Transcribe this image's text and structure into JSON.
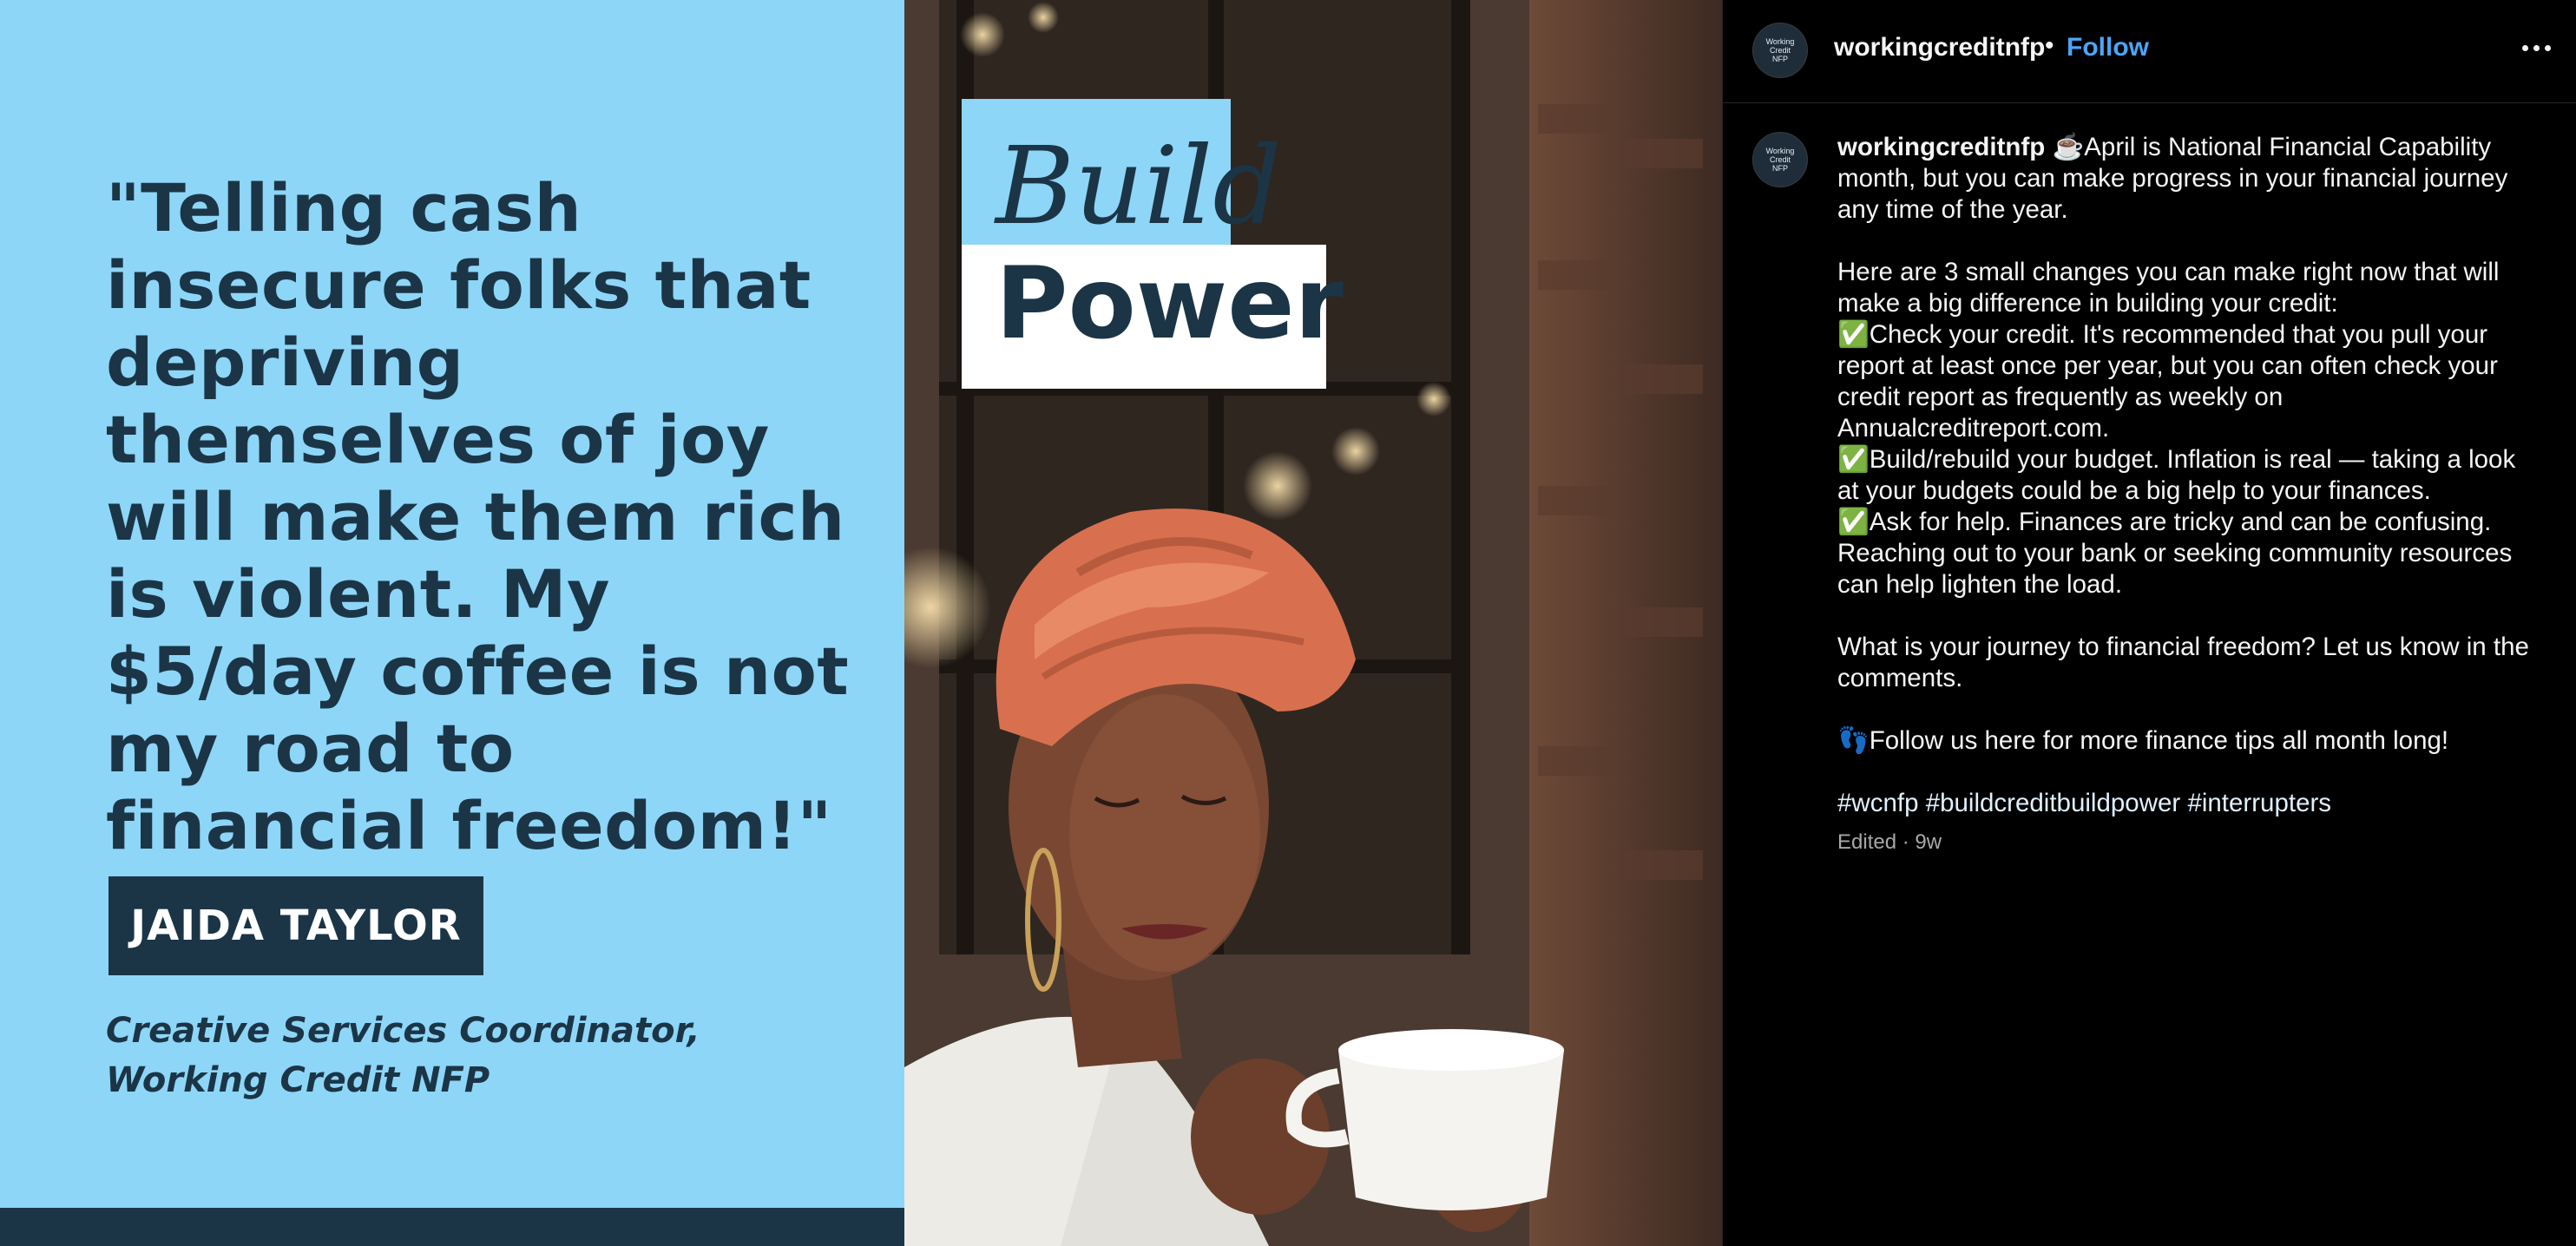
{
  "quote_panel": {
    "quote": "\"Telling cash insecure folks that depriving themselves of joy will make them rich is violent. My $5/day coffee is not my road to financial freedom!\"",
    "name": "JAIDA TAYLOR",
    "title_line1": "Creative Services Coordinator,",
    "title_line2": "Working Credit NFP"
  },
  "photo_panel": {
    "word1": "Build",
    "word2": "Power"
  },
  "post": {
    "username": "workingcreditnfp",
    "separator": "•",
    "follow_label": "Follow",
    "avatar_line1": "Working",
    "avatar_line2": "Credit",
    "avatar_line3": "NFP",
    "caption_intro": "☕️April is National Financial Capability month, but you can make progress in your financial journey any time of the year.",
    "caption_p2": "Here are 3 small changes you can make right now that will make a big difference in building your credit:",
    "caption_tip1": "✅Check your credit. It's recommended that you pull your report at least once per year, but you can often check your credit report as frequently as weekly on Annualcreditreport.com.",
    "caption_tip2": "✅Build/rebuild your budget. Inflation is real — taking a look at your budgets could be a big help to your finances.",
    "caption_tip3": "✅Ask for help. Finances are tricky and can be confusing. Reaching out to your bank or seeking community resources can help lighten the load.",
    "caption_question": "What is your journey to financial freedom? Let us know in the comments.",
    "caption_follow": "👣Follow us here for more finance tips all month long!",
    "hashtags": [
      "#wcnfp",
      "#buildcreditbuildpower",
      "#interrupters"
    ],
    "meta": "Edited · 9w"
  },
  "colors": {
    "light_blue": "#8ed6f7",
    "navy": "#1b3547",
    "follow_blue": "#4ca5f7"
  }
}
